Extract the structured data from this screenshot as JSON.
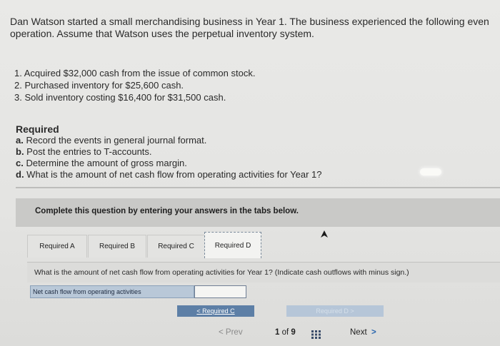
{
  "intro": {
    "line1": "Dan Watson started a small merchandising business in Year 1. The business experienced the following even",
    "line2": "operation. Assume that Watson uses the perpetual inventory system."
  },
  "events": [
    "1. Acquired $32,000 cash from the issue of common stock.",
    "2. Purchased inventory for $25,600 cash.",
    "3. Sold inventory costing $16,400 for $31,500 cash."
  ],
  "required": {
    "title": "Required",
    "items": [
      {
        "letter": "a.",
        "text": " Record the events in general journal format."
      },
      {
        "letter": "b.",
        "text": " Post the entries to T-accounts."
      },
      {
        "letter": "c.",
        "text": " Determine the amount of gross margin."
      },
      {
        "letter": "d.",
        "text": " What is the amount of net cash flow from operating activities for Year 1?"
      }
    ]
  },
  "banner": "Complete this question by entering your answers in the tabs below.",
  "tabs": [
    "Required A",
    "Required B",
    "Required C",
    "Required D"
  ],
  "active_tab": "Required D",
  "question": "What is the amount of net cash flow from operating activities for Year 1? (Indicate cash outflows with minus sign.)",
  "answer": {
    "label": "Net cash flow from operating activities",
    "value": ""
  },
  "nav": {
    "prev_required": "Required C",
    "next_required": "Required D"
  },
  "pager": {
    "prev": "Prev",
    "current": "1",
    "of": "of",
    "total": "9",
    "next": "Next"
  },
  "icons": {
    "prev_chevron": "chevron-left-icon",
    "next_chevron": "chevron-right-icon",
    "grid": "grid-icon",
    "cursor": "mouse-cursor-icon"
  }
}
